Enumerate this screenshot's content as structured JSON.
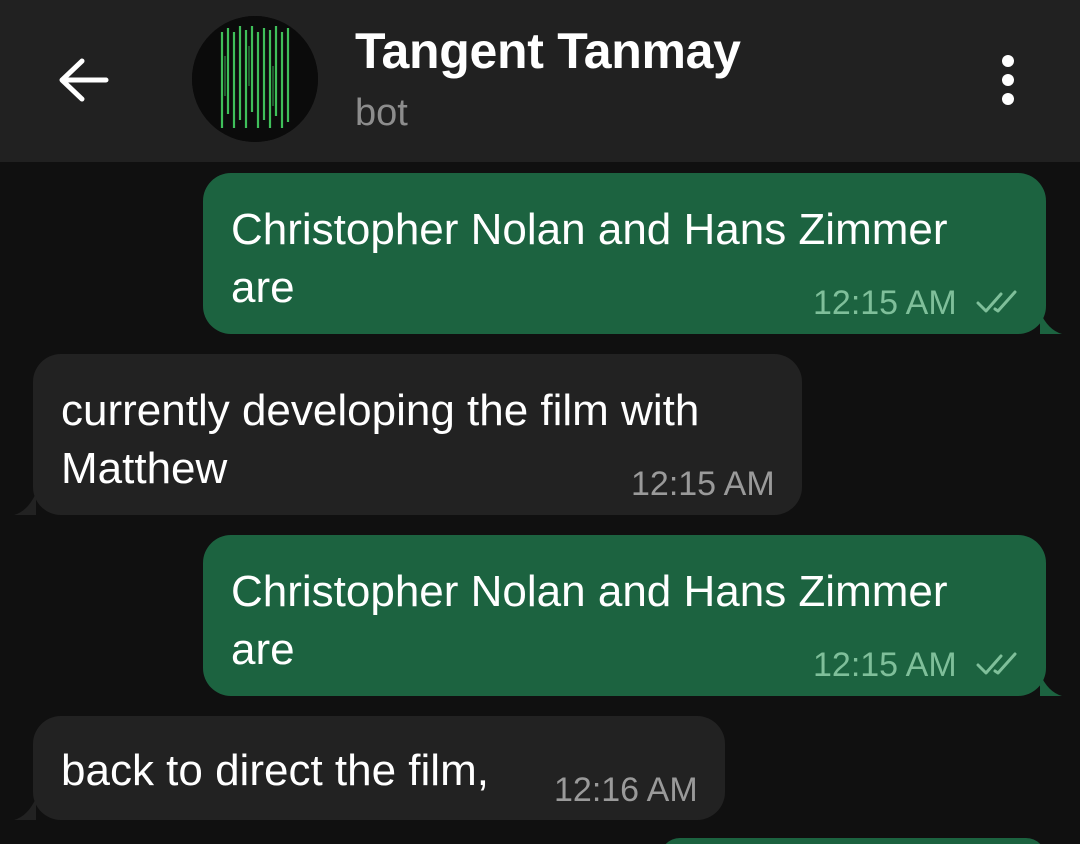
{
  "header": {
    "back_icon": "arrow-left-icon",
    "title": "Tangent Tanmay",
    "subtitle": "bot",
    "menu_icon": "more-vertical-icon"
  },
  "colors": {
    "header_bg": "#212121",
    "chat_bg": "#101010",
    "outgoing_bubble": "#1c6340",
    "incoming_bubble": "#222222",
    "avatar_stripes": "#3fbf5a"
  },
  "messages": [
    {
      "direction": "outgoing",
      "text": "Christopher Nolan and Hans Zimmer\nare",
      "time": "12:15 AM",
      "status_icon": "double-check-icon"
    },
    {
      "direction": "incoming",
      "text": "currently developing the film with\nMatthew",
      "time": "12:15 AM"
    },
    {
      "direction": "outgoing",
      "text": "Christopher Nolan and Hans Zimmer\nare",
      "time": "12:15 AM",
      "status_icon": "double-check-icon"
    },
    {
      "direction": "incoming",
      "text": "back to direct the film,",
      "time": "12:16 AM"
    }
  ]
}
